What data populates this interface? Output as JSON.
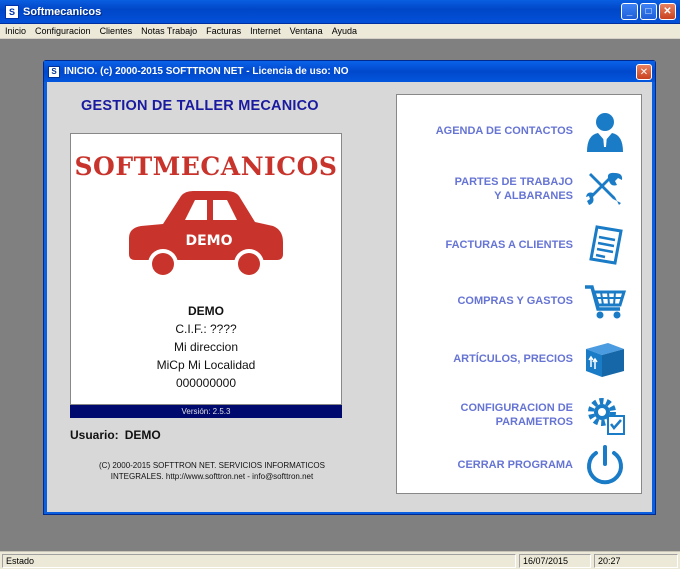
{
  "window": {
    "title": "Softmecanicos",
    "app_icon": "softmecanicos-app-icon"
  },
  "menu": [
    "Inicio",
    "Configuracion",
    "Clientes",
    "Notas Trabajo",
    "Facturas",
    "Internet",
    "Ventana",
    "Ayuda"
  ],
  "dialog": {
    "title": "INICIO.  (c) 2000-2015 SOFTTRON NET - Licencia de uso: NO",
    "heading": "GESTION DE TALLER MECANICO",
    "logo_text": "SOFTMECANICOS",
    "car_label": "DEMO",
    "company": {
      "name": "DEMO",
      "cif": "C.I.F.: ????",
      "address": "Mi direccion",
      "locality": "MiCp  Mi Localidad",
      "phone": "000000000"
    },
    "version": "Versión: 2.5.3",
    "user_label": "Usuario:",
    "user_value": "DEMO",
    "copyright_line1": "(C) 2000-2015 SOFTTRON NET. SERVICIOS INFORMATICOS",
    "copyright_line2": "INTEGRALES. http://www.softtron.net - info@softtron.net",
    "actions": [
      {
        "line1": "AGENDA DE CONTACTOS",
        "line2": "",
        "icon": "contact-person-icon"
      },
      {
        "line1": "PARTES DE TRABAJO",
        "line2": "Y ALBARANES",
        "icon": "tools-wrench-screwdriver-icon"
      },
      {
        "line1": "FACTURAS A CLIENTES",
        "line2": "",
        "icon": "invoice-document-icon"
      },
      {
        "line1": "COMPRAS Y GASTOS",
        "line2": "",
        "icon": "shopping-cart-icon"
      },
      {
        "line1": "ARTÍCULOS, PRECIOS",
        "line2": "",
        "icon": "box-package-icon"
      },
      {
        "line1": "CONFIGURACION DE",
        "line2": "PARAMETROS",
        "icon": "gear-checklist-icon"
      },
      {
        "line1": "CERRAR PROGRAMA",
        "line2": "",
        "icon": "power-icon"
      }
    ]
  },
  "status": {
    "label": "Estado",
    "date": "16/07/2015",
    "time": "20:27"
  },
  "colors": {
    "accent_blue": "#1a7bc6",
    "action_text": "#6674d4",
    "logo_red": "#c8342c",
    "heading_blue": "#1a1aa0"
  }
}
